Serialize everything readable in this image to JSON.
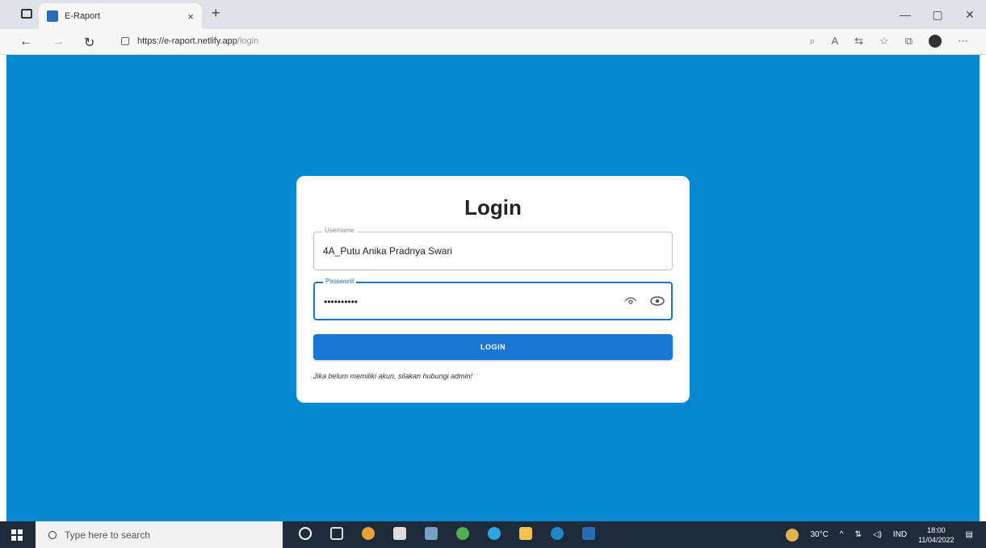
{
  "browser": {
    "tab_title": "E-Raport",
    "tab_close": "×",
    "new_tab": "+",
    "url_host": "https://e-raport.netlify.app",
    "url_path": "/login",
    "win_min": "—",
    "win_max": "▢",
    "win_close": "✕"
  },
  "login": {
    "title": "Login",
    "username_label": "Username",
    "username_value": "4A_Putu Anika Pradnya Swari",
    "password_label": "Password",
    "password_value": "••••••••••",
    "button_label": "LOGIN",
    "hint": "Jika belum memiliki akun, silakan hubungi admin!"
  },
  "taskbar": {
    "search_placeholder": "Type here to search",
    "weather": "30°C",
    "language": "IND",
    "time": "18:00",
    "date": "11/04/2022"
  },
  "colors": {
    "page_bg": "#0489d1",
    "accent": "#1976d2"
  }
}
